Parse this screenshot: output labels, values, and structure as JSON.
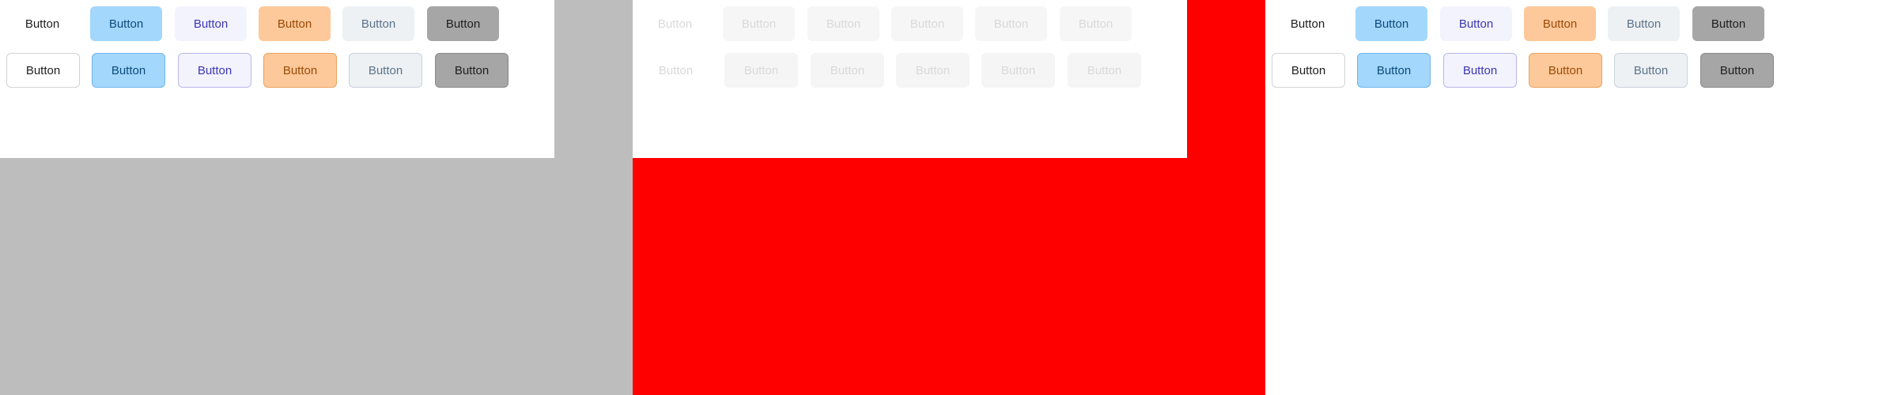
{
  "button_label": "Button",
  "colors": {
    "panel_a_background": "#bdbdbd",
    "panel_b_background": "#ff0000",
    "panel_c_background": "#ffffff",
    "frame_background": "#ffffff"
  }
}
